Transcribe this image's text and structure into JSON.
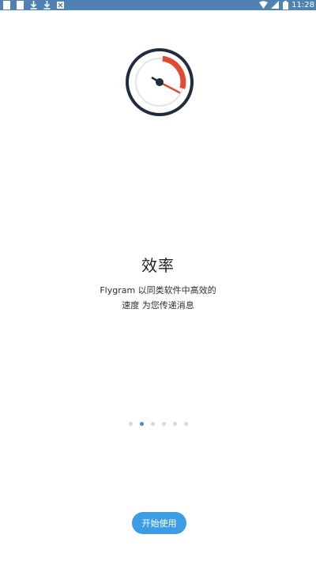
{
  "status_bar": {
    "time": "11:28",
    "left_icons": [
      "notification-icon",
      "notification-icon",
      "download-icon",
      "download-icon",
      "app-icon"
    ],
    "right_icons": [
      "wifi-icon",
      "signal-icon",
      "battery-icon"
    ],
    "background_color": "#4f82b3"
  },
  "onboarding": {
    "title": "效率",
    "description_line1": "Flygram 以同类软件中高效的",
    "description_line2": "速度 为您传递消息",
    "page_count": 6,
    "active_page_index": 1,
    "start_button_label": "开始使用"
  },
  "colors": {
    "accent": "#3d9de4",
    "gauge_ring": "#1f2d3d",
    "gauge_arc": "#e24a33",
    "active_dot": "#3f8fe0",
    "inactive_dot": "#d4d7dc"
  }
}
